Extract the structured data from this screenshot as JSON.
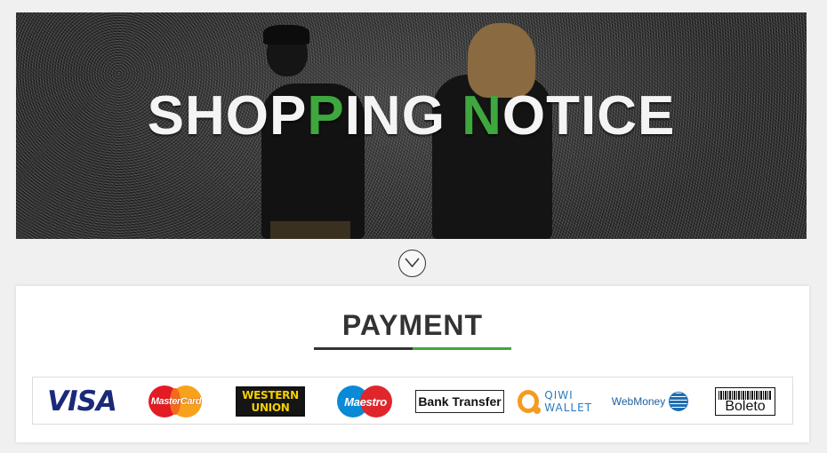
{
  "banner": {
    "title_parts": [
      "SHOP",
      "P",
      "ING ",
      "N",
      "OTICE"
    ]
  },
  "payment": {
    "title": "PAYMENT",
    "methods": [
      {
        "label": "VISA",
        "icon": "visa-logo"
      },
      {
        "label": "MasterCard",
        "icon": "mastercard-logo"
      },
      {
        "label_lines": [
          "WESTERN",
          "UNION"
        ],
        "icon": "western-union-logo"
      },
      {
        "label": "Maestro",
        "icon": "maestro-logo"
      },
      {
        "label": "Bank Transfer",
        "icon": "bank-transfer-logo"
      },
      {
        "label_lines": [
          "QIWI",
          "WALLET"
        ],
        "icon": "qiwi-wallet-logo"
      },
      {
        "label": "WebMoney",
        "icon": "webmoney-logo"
      },
      {
        "label": "Boleto",
        "icon": "boleto-logo"
      }
    ]
  },
  "colors": {
    "accent_green": "#3ea73e",
    "title_dark": "#333333"
  }
}
